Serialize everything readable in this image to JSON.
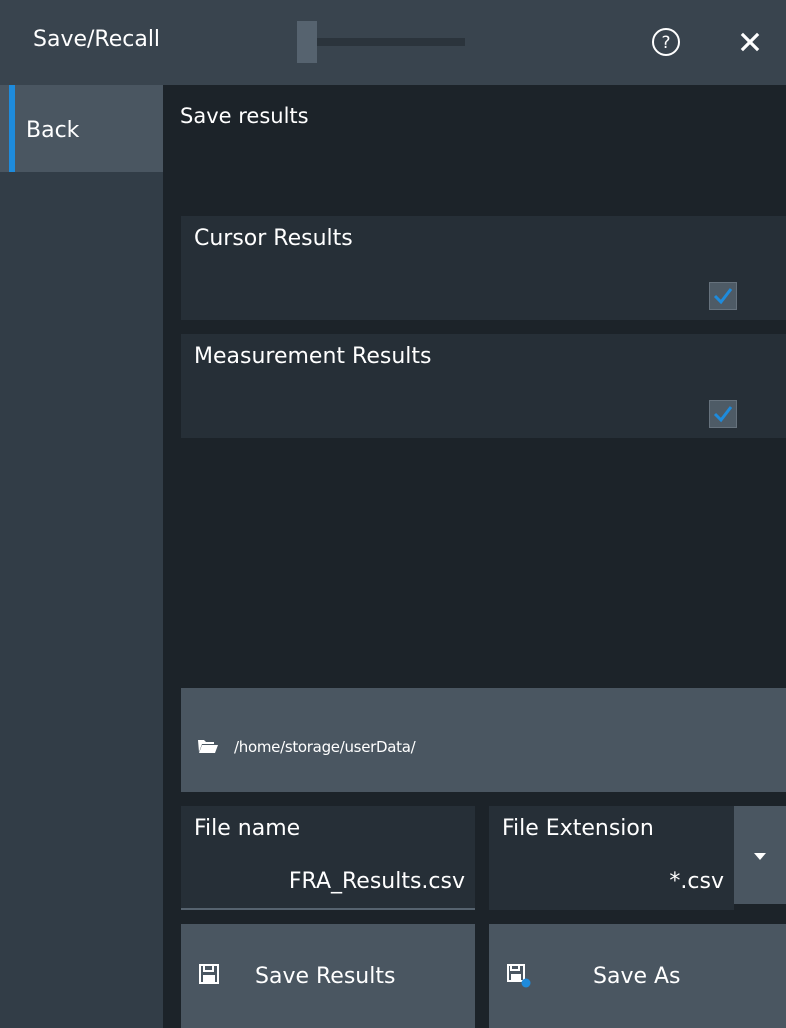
{
  "titlebar": {
    "title": "Save/Recall"
  },
  "sidebar": {
    "back_label": "Back"
  },
  "main": {
    "section_title": "Save results",
    "options": [
      {
        "label": "Cursor Results",
        "checked": true
      },
      {
        "label": "Measurement Results",
        "checked": true
      }
    ],
    "path": "/home/storage/userData/",
    "file_name": {
      "label": "File name",
      "value": "FRA_Results.csv"
    },
    "file_extension": {
      "label": "File Extension",
      "value": "*.csv"
    },
    "buttons": {
      "save_results": "Save Results",
      "save_as": "Save As"
    }
  },
  "colors": {
    "accent": "#1e8bdc",
    "background": "#1c2329",
    "panel": "#262f37",
    "button": "#4a5661"
  }
}
